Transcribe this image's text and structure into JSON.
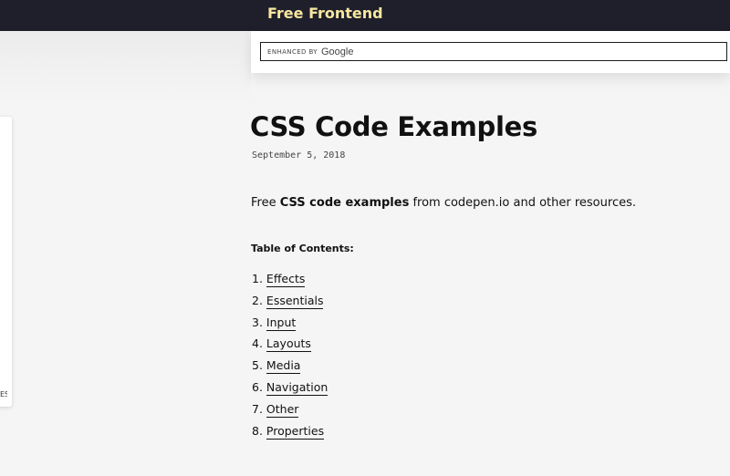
{
  "header": {
    "brand": "Free Frontend"
  },
  "search": {
    "enhanced_by": "ENHANCED BY",
    "provider": "Google"
  },
  "sidebar": {
    "partial_text": "ES"
  },
  "article": {
    "title": "CSS Code Examples",
    "date": "September 5, 2018",
    "intro": {
      "prefix": "Free ",
      "bold": "CSS code examples",
      "suffix": " from codepen.io and other resources."
    },
    "toc_heading": "Table of Contents:",
    "toc": [
      {
        "num": "1.",
        "label": "Effects"
      },
      {
        "num": "2.",
        "label": "Essentials"
      },
      {
        "num": "3.",
        "label": "Input"
      },
      {
        "num": "4.",
        "label": "Layouts"
      },
      {
        "num": "5.",
        "label": "Media"
      },
      {
        "num": "6.",
        "label": "Navigation"
      },
      {
        "num": "7.",
        "label": "Other"
      },
      {
        "num": "8.",
        "label": "Properties"
      }
    ]
  },
  "colors": {
    "topbar_bg": "#1f1f2b",
    "brand": "#f7e7a1",
    "page_bg": "#f5f5f5"
  }
}
